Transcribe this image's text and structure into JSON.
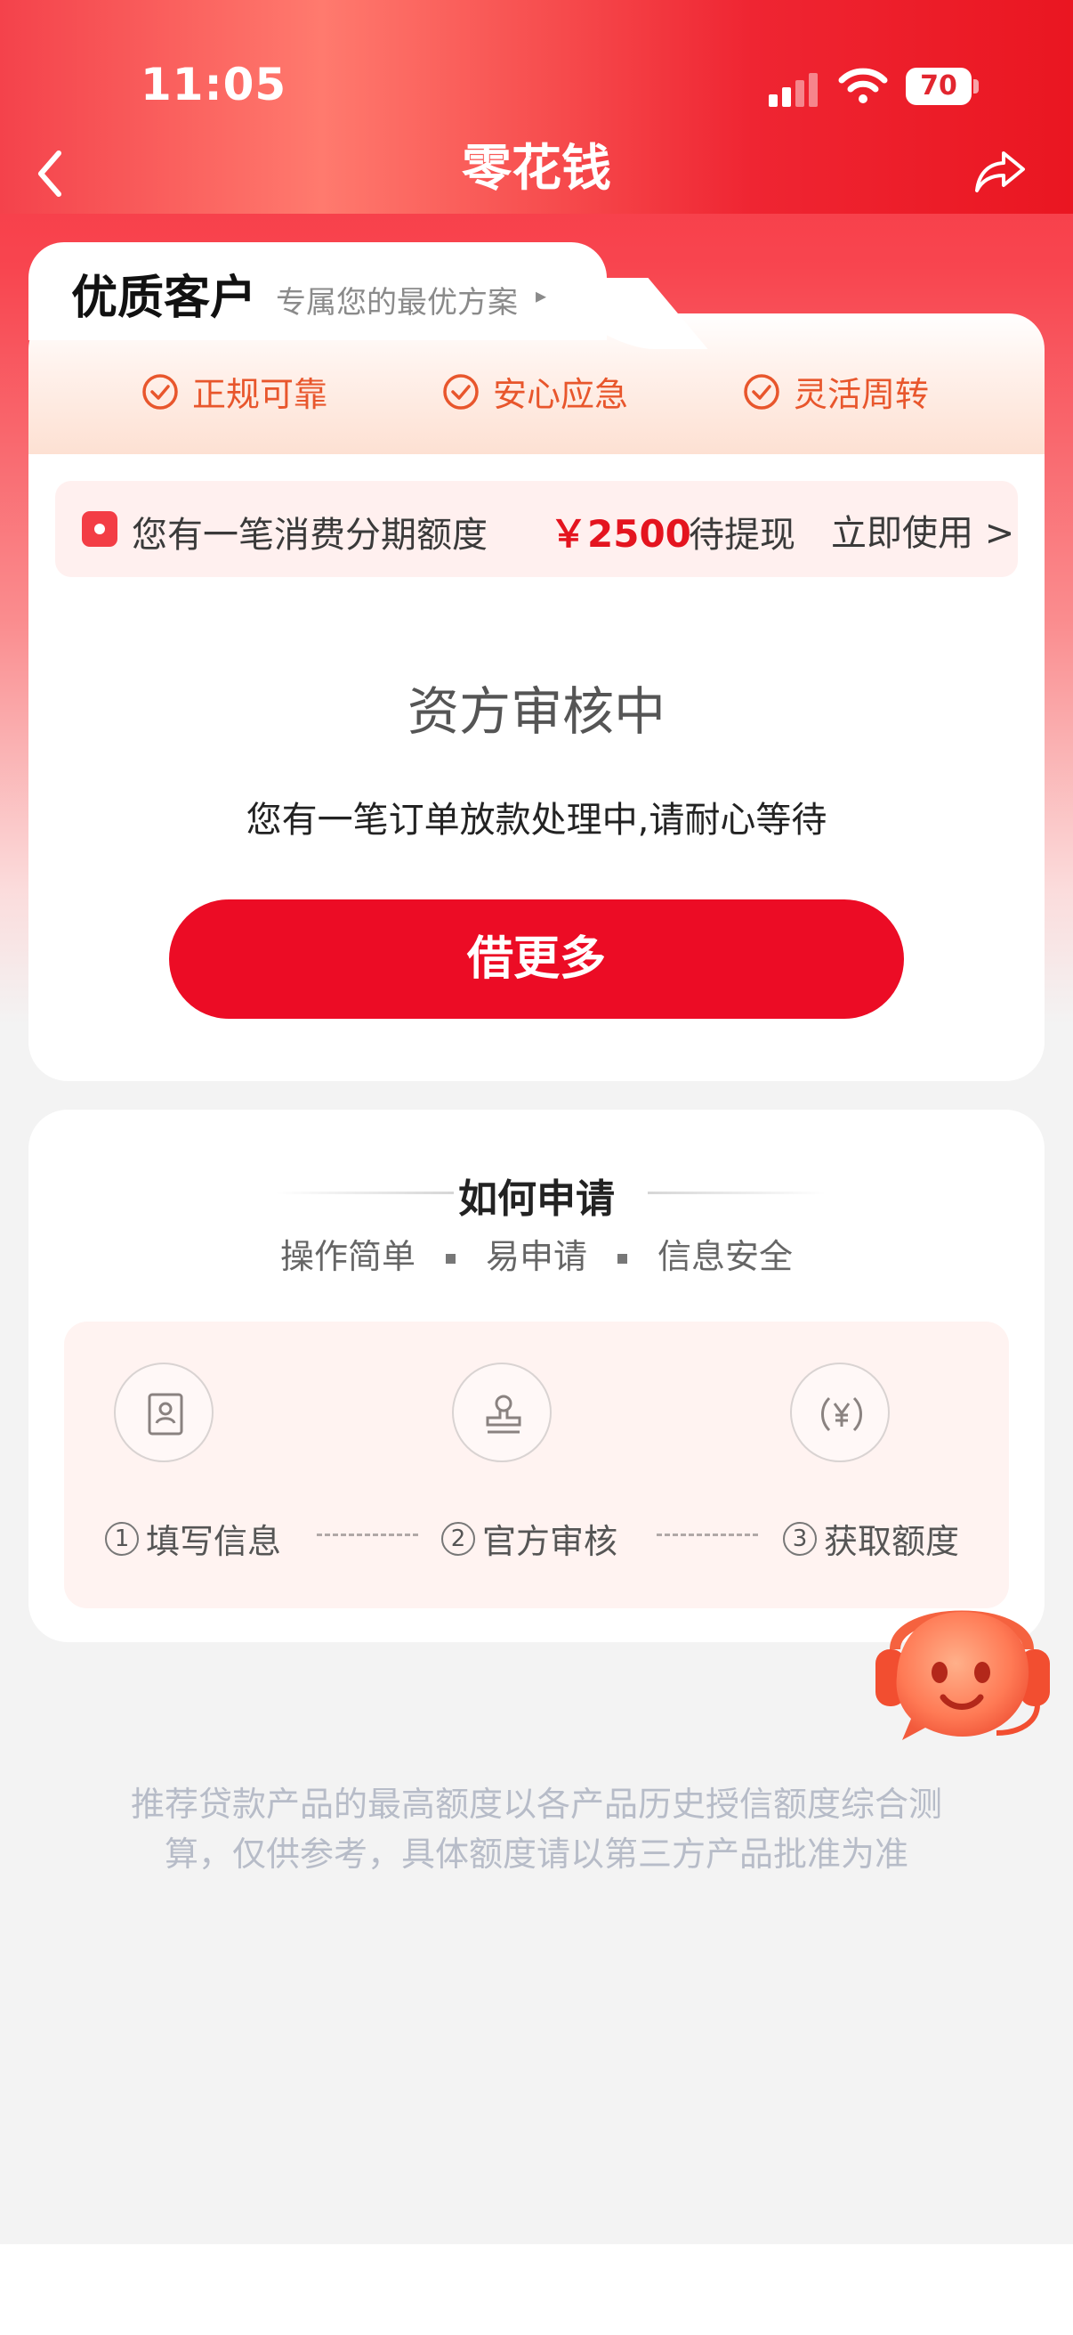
{
  "status_bar": {
    "time": "11:05",
    "battery": "70"
  },
  "nav": {
    "title": "零花钱"
  },
  "vip_card": {
    "title": "优质客户",
    "subtitle": "专属您的最优方案",
    "arrow": "▸",
    "features": [
      "正规可靠",
      "安心应急",
      "灵活周转"
    ],
    "quota": {
      "text": "您有一笔消费分期额度",
      "amount": "￥2500",
      "status": "待提现",
      "cta": "立即使用 >"
    },
    "review_title": "资方审核中",
    "review_desc": "您有一笔订单放款处理中,请耐心等待",
    "button": "借更多"
  },
  "how_card": {
    "title": "如何申请",
    "tags": [
      "操作简单",
      "易申请",
      "信息安全"
    ],
    "steps": [
      {
        "num": "1",
        "label": "填写信息",
        "icon": "form-icon"
      },
      {
        "num": "2",
        "label": "官方审核",
        "icon": "stamp-icon"
      },
      {
        "num": "3",
        "label": "获取额度",
        "icon": "yuan-icon"
      }
    ]
  },
  "disclaimer": "推荐贷款产品的最高额度以各产品历史授信额度综合测算，仅供参考，具体额度请以第三方产品批准为准",
  "colors": {
    "primary": "#ec0c25",
    "accent": "#e8562c"
  }
}
